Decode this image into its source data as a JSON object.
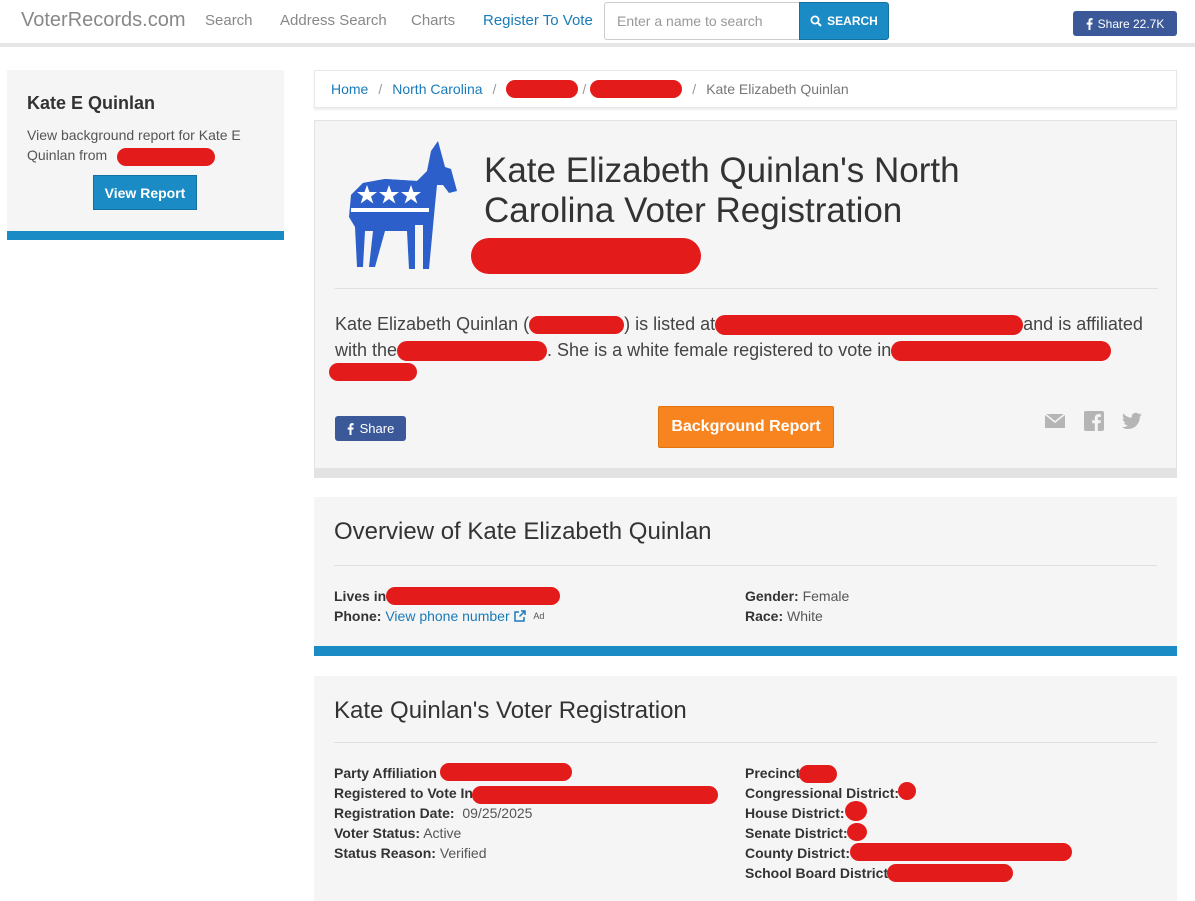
{
  "nav": {
    "brand": "VoterRecords.com",
    "links": [
      "Search",
      "Address Search",
      "Charts",
      "Register To Vote"
    ],
    "search_placeholder": "Enter a name to search",
    "search_label": "SEARCH",
    "share_label": "Share 22.7K"
  },
  "sidebar": {
    "title": "Kate E Quinlan",
    "text": "View background report for Kate E Quinlan from",
    "button": "View Report"
  },
  "breadcrumb": {
    "home": "Home",
    "state": "North Carolina",
    "current": "Kate Elizabeth Quinlan",
    "sep": "/"
  },
  "main": {
    "title": "Kate Elizabeth Quinlan's North Carolina Voter Registration",
    "desc_1": "Kate Elizabeth Quinlan (",
    "desc_2": ") is listed at",
    "desc_3": "and is affiliated with the",
    "desc_4": ". She is a white female registered to vote in",
    "share_label": "Share",
    "background_report": "Background Report"
  },
  "overview": {
    "title": "Overview of Kate Elizabeth Quinlan",
    "lives_in_label": "Lives in:",
    "phone_label": "Phone:",
    "phone_link": "View phone number",
    "ad": "Ad",
    "gender_label": "Gender:",
    "gender": "Female",
    "race_label": "Race:",
    "race": "White"
  },
  "registration": {
    "title": "Kate Quinlan's Voter Registration",
    "party_label": "Party Affiliation",
    "registered_label": "Registered to Vote In",
    "reg_date_label": "Registration Date:",
    "reg_date": "09/25/2025",
    "status_label": "Voter Status:",
    "status": "Active",
    "reason_label": "Status Reason:",
    "reason": "Verified",
    "precinct_label": "Precinct",
    "congressional_label": "Congressional District:",
    "house_label": "House District:",
    "senate_label": "Senate District:",
    "county_label": "County District:",
    "school_label": "School Board District:"
  },
  "colors": {
    "primary": "#1a8bc4",
    "orange": "#f7841f",
    "facebook": "#3b5998",
    "donkey_blue": "#2c5fc9",
    "redaction": "#e41b1b"
  }
}
